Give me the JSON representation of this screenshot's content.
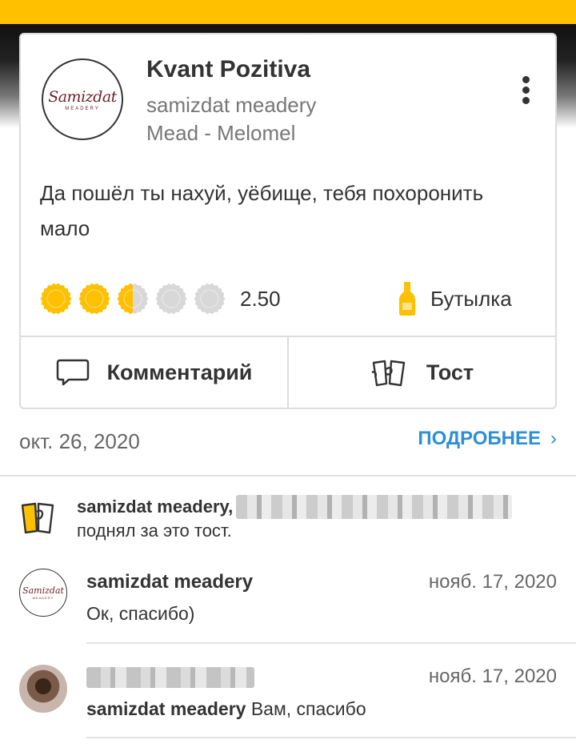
{
  "checkin": {
    "beer_name": "Kvant Pozitiva",
    "brewery": "samizdat meadery",
    "style": "Mead - Melomel",
    "brewery_logo": {
      "script": "Samizdat",
      "sub": "MEADERY"
    },
    "review_text": "Да пошёл ты нахуй, уёбище, тебя похоронить мало",
    "rating": {
      "value": "2.50",
      "max": 5,
      "filled": 2.5
    },
    "serving": {
      "label": "Бутылка",
      "icon": "bottle-icon"
    },
    "actions": {
      "comment": "Комментарий",
      "toast": "Тост"
    },
    "date": "окт. 26, 2020",
    "details_link": "ПОДРОБНЕЕ",
    "details_chevron": "›"
  },
  "toasts": {
    "user": "samizdat meadery,",
    "text": "поднял за это тост."
  },
  "comments": [
    {
      "author": "samizdat meadery",
      "date": "нояб. 17, 2020",
      "text": "Ок, спасибо)"
    },
    {
      "author": "",
      "date": "нояб. 17, 2020",
      "mention": "samizdat meadery",
      "text": " Вам, спасибо"
    }
  ],
  "colors": {
    "accent": "#ffc000",
    "link": "#2e8fd6",
    "cap_empty": "#d8d8d8"
  }
}
